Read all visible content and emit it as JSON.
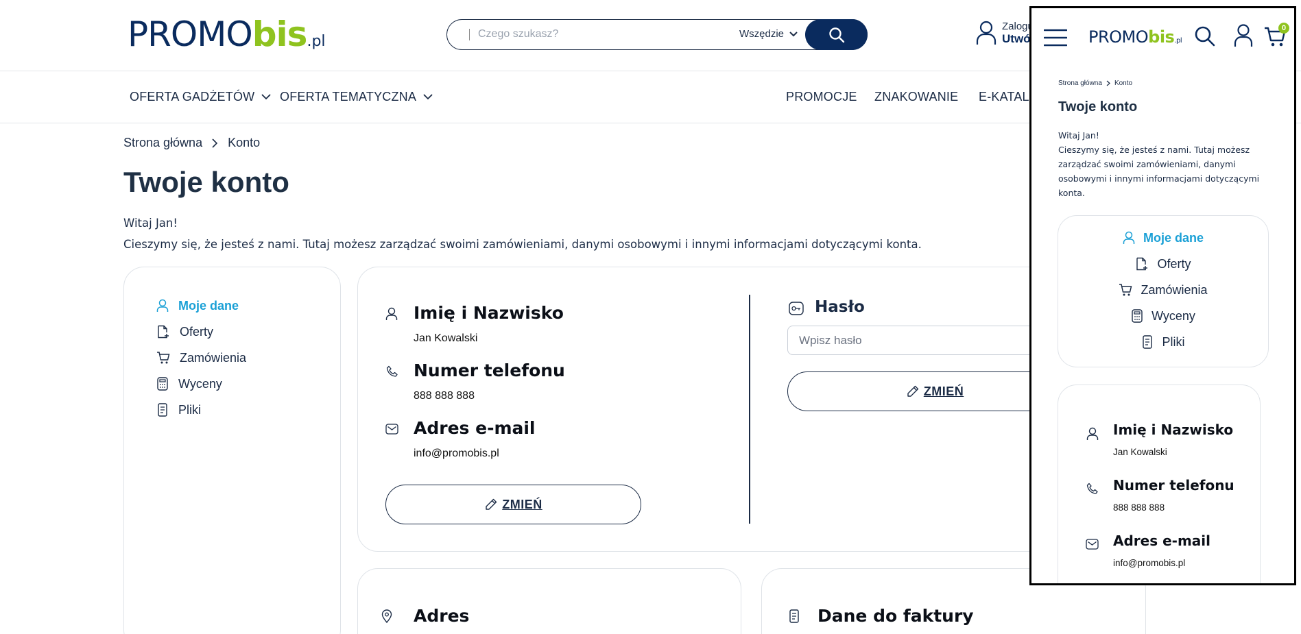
{
  "header": {
    "logo": {
      "main": "PROMO",
      "accent": "bis",
      "suffix": ".pl"
    },
    "search": {
      "placeholder": "Czego szukasz?",
      "scope": "Wszędzie"
    },
    "account": {
      "line1": "Zalogu",
      "line2": "Utwó"
    }
  },
  "nav": {
    "left": [
      "OFERTA GADŻETÓW",
      "OFERTA TEMATYCZNA"
    ],
    "right": [
      "PROMOCJE",
      "ZNAKOWANIE",
      "E-KATALO"
    ]
  },
  "breadcrumb": [
    "Strona główna",
    "Konto"
  ],
  "page": {
    "title": "Twoje konto",
    "greeting": "Witaj Jan!",
    "intro": "Cieszymy się, że jesteś z nami. Tutaj możesz zarządzać swoimi zamówieniami, danymi osobowymi i innymi informacjami dotyczącymi konta."
  },
  "account_menu": [
    {
      "label": "Moje dane",
      "icon": "user-icon",
      "active": true
    },
    {
      "label": "Oferty",
      "icon": "offer-icon",
      "active": false
    },
    {
      "label": "Zamówienia",
      "icon": "cart-icon",
      "active": false
    },
    {
      "label": "Wyceny",
      "icon": "calculator-icon",
      "active": false
    },
    {
      "label": "Pliki",
      "icon": "file-icon",
      "active": false
    }
  ],
  "personal": {
    "name_label": "Imię i Nazwisko",
    "name_value": "Jan Kowalski",
    "phone_label": "Numer telefonu",
    "phone_value": "888 888 888",
    "email_label": "Adres e-mail",
    "email_value": "info@promobis.pl",
    "change_label": "ZMIEŃ"
  },
  "password": {
    "label": "Hasło",
    "placeholder": "Wpisz hasło",
    "change_label": "ZMIEŃ"
  },
  "sections": {
    "address_label": "Adres",
    "invoice_label": "Dane do faktury"
  },
  "mobile": {
    "cart_count": "0",
    "breadcrumb": [
      "Strona główna",
      "Konto"
    ],
    "title": "Twoje konto",
    "greeting": "Witaj Jan!",
    "intro": "Cieszymy się, że jesteś z nami. Tutaj możesz zarządzać swoimi zamówieniami, danymi osobowymi i innymi informacjami dotyczącymi konta."
  },
  "colors": {
    "brand": "#0a2b5e",
    "accent": "#8fc31f",
    "active": "#1aa0d6"
  }
}
